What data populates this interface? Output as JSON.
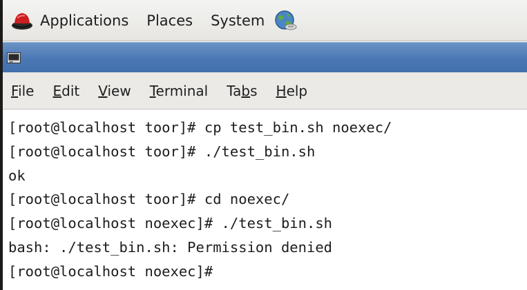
{
  "panel": {
    "menus": [
      "Applications",
      "Places",
      "System"
    ],
    "icons": [
      "redhat-logo-icon",
      "network-globe-icon"
    ]
  },
  "window": {
    "title_icon": "terminal-icon"
  },
  "menubar": {
    "items": [
      {
        "label_pre": "",
        "mnemonic": "F",
        "label_post": "ile"
      },
      {
        "label_pre": "",
        "mnemonic": "E",
        "label_post": "dit"
      },
      {
        "label_pre": "",
        "mnemonic": "V",
        "label_post": "iew"
      },
      {
        "label_pre": "",
        "mnemonic": "T",
        "label_post": "erminal"
      },
      {
        "label_pre": "Ta",
        "mnemonic": "b",
        "label_post": "s"
      },
      {
        "label_pre": "",
        "mnemonic": "H",
        "label_post": "elp"
      }
    ]
  },
  "terminal": {
    "lines": [
      "[root@localhost toor]# cp test_bin.sh noexec/",
      "[root@localhost toor]# ./test_bin.sh",
      "ok",
      "[root@localhost toor]# cd noexec/",
      "[root@localhost noexec]# ./test_bin.sh",
      "bash: ./test_bin.sh: Permission denied",
      "[root@localhost noexec]#"
    ]
  }
}
